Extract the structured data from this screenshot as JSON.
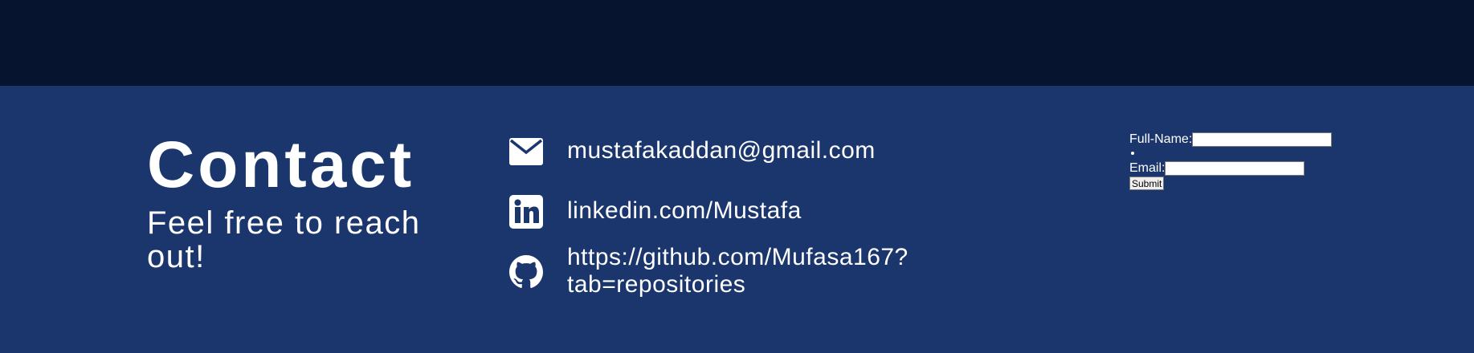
{
  "contact": {
    "heading": "Contact",
    "subheading": "Feel free to reach out!"
  },
  "links": {
    "email": {
      "text": "mustafakaddan@gmail.com",
      "icon": "envelope-icon"
    },
    "linkedin": {
      "text": "linkedin.com/Mustafa",
      "icon": "linkedin-icon"
    },
    "github": {
      "text": "https://github.com/Mufasa167?tab=repositories",
      "icon": "github-icon"
    }
  },
  "form": {
    "name_label": "Full-Name:",
    "name_value": "",
    "email_label": "Email:",
    "email_value": "",
    "submit_label": "Submit"
  },
  "colors": {
    "top_band": "#061430",
    "section_bg": "#1b366d",
    "text": "#ffffff"
  }
}
